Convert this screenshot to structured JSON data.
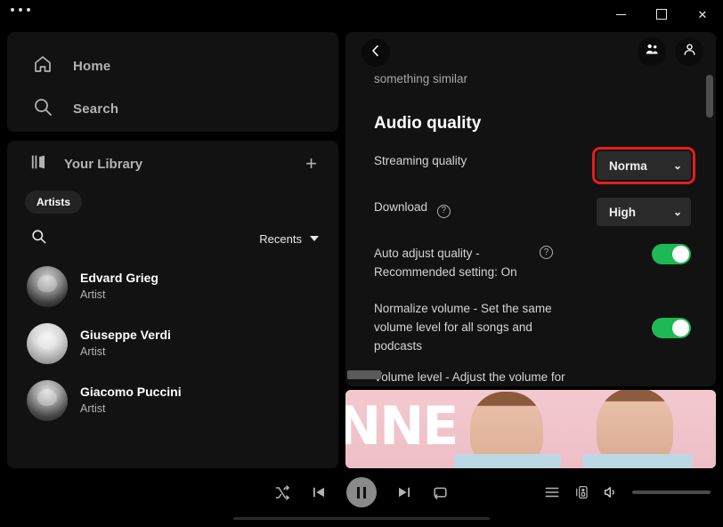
{
  "window": {
    "menu_dots": "…",
    "minimize_label": "Minimize",
    "maximize_label": "Maximize",
    "close_label": "✕"
  },
  "sidebar": {
    "nav": [
      {
        "label": "Home",
        "icon": "home-icon"
      },
      {
        "label": "Search",
        "icon": "search-icon"
      }
    ],
    "library": {
      "title": "Your Library",
      "add_label": "+",
      "filter_chips": [
        {
          "label": "Artists",
          "active": true
        }
      ],
      "sort_label": "Recents",
      "search_icon": "search-icon",
      "items": [
        {
          "name": "Edvard Grieg",
          "type": "Artist"
        },
        {
          "name": "Giuseppe Verdi",
          "type": "Artist"
        },
        {
          "name": "Giacomo Puccini",
          "type": "Artist"
        }
      ]
    }
  },
  "settings": {
    "back_label": "Back",
    "friends_icon": "friends-icon",
    "profile_icon": "profile-icon",
    "clipped_text": "something similar",
    "section_title": "Audio quality",
    "rows": [
      {
        "label": "Streaming quality",
        "control": "dropdown",
        "value": "Norma",
        "highlighted": true,
        "has_help": false
      },
      {
        "label": "Download",
        "control": "dropdown",
        "value": "High",
        "highlighted": false,
        "has_help": true
      },
      {
        "label": "Auto adjust quality - Recommended setting: On",
        "control": "toggle",
        "value": "on",
        "has_help": true,
        "help_position": "far"
      },
      {
        "label": "Normalize volume - Set the same volume level for all songs and podcasts",
        "control": "toggle",
        "value": "on",
        "has_help": false
      },
      {
        "label": "Volume level - Adjust the volume for your environment. Loud may",
        "control": "none",
        "has_help": false
      }
    ],
    "help_glyph": "?"
  },
  "banner": {
    "text": "NNE",
    "alt": "album-artwork-banner"
  },
  "player": {
    "shuffle_label": "Shuffle",
    "previous_label": "Previous",
    "play_pause_label": "Pause",
    "play_state": "playing",
    "next_label": "Next",
    "repeat_label": "Repeat",
    "queue_label": "Queue",
    "devices_label": "Connect to a device",
    "volume_label": "Volume",
    "volume_percent": 100,
    "progress_percent": 0
  },
  "colors": {
    "accent_green": "#1db954",
    "highlight_red": "#e81c1c",
    "panel_bg": "#121212",
    "app_bg": "#000000",
    "text_primary": "#ffffff",
    "text_secondary": "#b3b3b3",
    "dropdown_bg": "#2a2a2a",
    "banner_pink": "#f0c5cc"
  }
}
